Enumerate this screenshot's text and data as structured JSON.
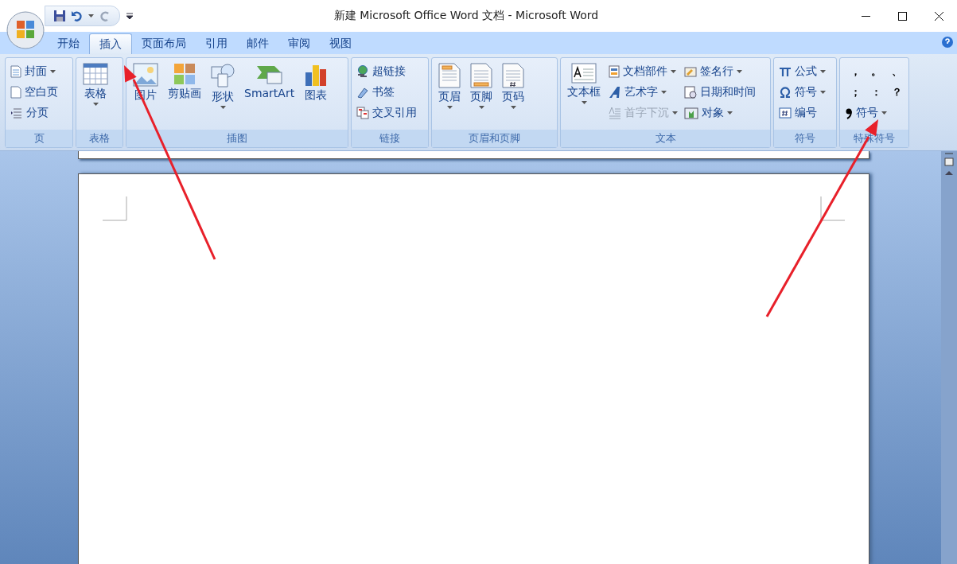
{
  "window": {
    "title": "新建 Microsoft Office Word 文档 - Microsoft Word"
  },
  "tabs": [
    {
      "label": "开始",
      "selected": false
    },
    {
      "label": "插入",
      "selected": true
    },
    {
      "label": "页面布局",
      "selected": false
    },
    {
      "label": "引用",
      "selected": false
    },
    {
      "label": "邮件",
      "selected": false
    },
    {
      "label": "审阅",
      "selected": false
    },
    {
      "label": "视图",
      "selected": false
    }
  ],
  "groups": [
    {
      "label": "页",
      "items": [
        {
          "kind": "small",
          "label": "封面",
          "dropdown": true,
          "disabled": false
        },
        {
          "kind": "small",
          "label": "空白页",
          "dropdown": false,
          "disabled": false
        },
        {
          "kind": "small",
          "label": "分页",
          "dropdown": false,
          "disabled": false
        }
      ]
    },
    {
      "label": "表格",
      "items": [
        {
          "kind": "large",
          "label": "表格",
          "dropdown": true,
          "disabled": false
        }
      ]
    },
    {
      "label": "插图",
      "items": [
        {
          "kind": "large",
          "label": "图片",
          "dropdown": false,
          "disabled": false
        },
        {
          "kind": "large",
          "label": "剪贴画",
          "dropdown": false,
          "disabled": false
        },
        {
          "kind": "large",
          "label": "形状",
          "dropdown": true,
          "disabled": false
        },
        {
          "kind": "large",
          "label": "SmartArt",
          "dropdown": false,
          "disabled": false
        },
        {
          "kind": "large",
          "label": "图表",
          "dropdown": false,
          "disabled": false
        }
      ]
    },
    {
      "label": "链接",
      "items": [
        {
          "kind": "small",
          "label": "超链接",
          "dropdown": false,
          "disabled": false
        },
        {
          "kind": "small",
          "label": "书签",
          "dropdown": false,
          "disabled": false
        },
        {
          "kind": "small",
          "label": "交叉引用",
          "dropdown": false,
          "disabled": false
        }
      ]
    },
    {
      "label": "页眉和页脚",
      "items": [
        {
          "kind": "large",
          "label": "页眉",
          "dropdown": true,
          "disabled": false
        },
        {
          "kind": "large",
          "label": "页脚",
          "dropdown": true,
          "disabled": false
        },
        {
          "kind": "large",
          "label": "页码",
          "dropdown": true,
          "disabled": false
        }
      ]
    },
    {
      "label": "文本",
      "items": [
        {
          "kind": "large",
          "label": "文本框",
          "dropdown": true,
          "disabled": false
        },
        {
          "kind": "small",
          "label": "文档部件",
          "dropdown": true,
          "disabled": false
        },
        {
          "kind": "small",
          "label": "艺术字",
          "dropdown": true,
          "disabled": false
        },
        {
          "kind": "small",
          "label": "首字下沉",
          "dropdown": true,
          "disabled": true
        },
        {
          "kind": "small",
          "label": "签名行",
          "dropdown": true,
          "disabled": false
        },
        {
          "kind": "small",
          "label": "日期和时间",
          "dropdown": false,
          "disabled": false
        },
        {
          "kind": "small",
          "label": "对象",
          "dropdown": true,
          "disabled": false
        }
      ]
    },
    {
      "label": "符号",
      "items": [
        {
          "kind": "small",
          "label": "公式",
          "dropdown": true,
          "disabled": false
        },
        {
          "kind": "small",
          "label": "符号",
          "dropdown": true,
          "disabled": false
        },
        {
          "kind": "small",
          "label": "编号",
          "dropdown": false,
          "disabled": false
        }
      ]
    },
    {
      "label": "特殊符号",
      "items": [
        {
          "kind": "marks",
          "marks": [
            "，",
            "。",
            "、",
            "；",
            "：",
            "？"
          ]
        },
        {
          "kind": "small",
          "label": "符号",
          "dropdown": true,
          "disabled": false
        }
      ]
    }
  ]
}
